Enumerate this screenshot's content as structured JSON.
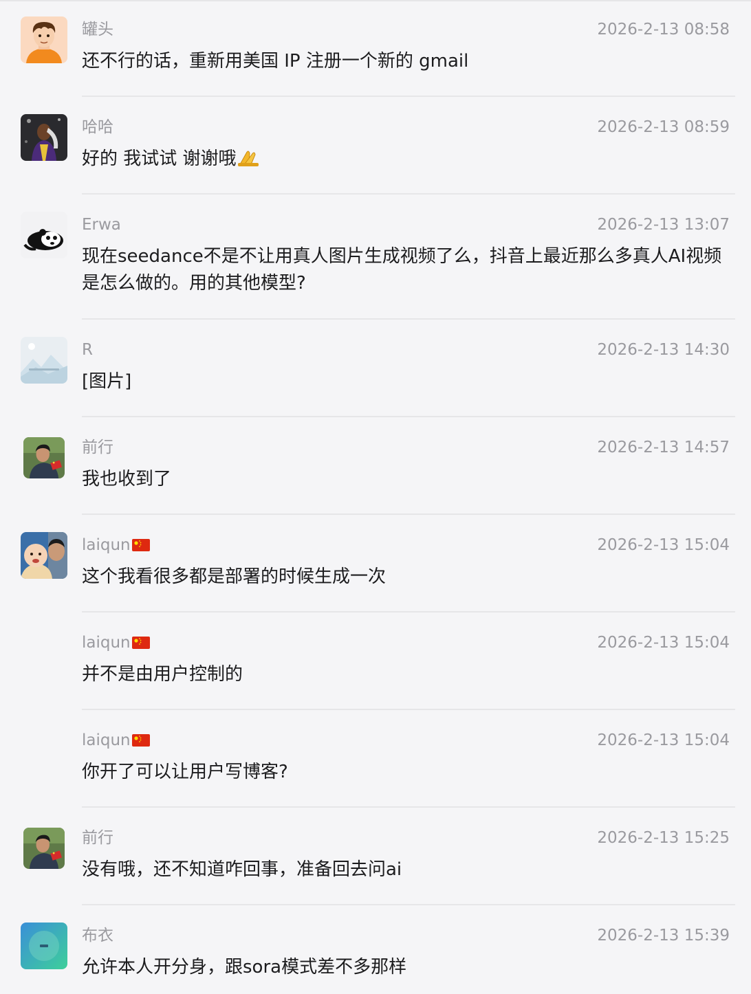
{
  "messages": [
    {
      "name": "罐头",
      "time": "2026-2-13 08:58",
      "text": "还不行的话，重新用美国 IP 注册一个新的 gmail",
      "avatar": "cartoon-boy-avatar"
    },
    {
      "name": "哈哈",
      "time": "2026-2-13 08:59",
      "text": "好的 我试试 谢谢哦",
      "emoji": "folded-hands-icon",
      "avatar": "basketball-player-avatar"
    },
    {
      "name": "Erwa",
      "time": "2026-2-13 13:07",
      "text": "现在seedance不是不让用真人图片生成视频了么，抖音上最近那么多真人AI视频是怎么做的。用的其他模型?",
      "avatar": "panda-avatar"
    },
    {
      "name": "R",
      "time": "2026-2-13 14:30",
      "text": "[图片]",
      "avatar": "landscape-avatar"
    },
    {
      "name": "前行",
      "time": "2026-2-13 14:57",
      "text": "我也收到了",
      "avatar": "man-with-flag-avatar"
    },
    {
      "name": "laiqun",
      "time": "2026-2-13 15:04",
      "text": "这个我看很多都是部署的时候生成一次",
      "flag": "cn-flag-icon",
      "avatar": "family-photo-avatar"
    },
    {
      "name": "laiqun",
      "time": "2026-2-13 15:04",
      "text": "并不是由用户控制的",
      "flag": "cn-flag-icon"
    },
    {
      "name": "laiqun",
      "time": "2026-2-13 15:04",
      "text": "你开了可以让用户写博客?",
      "flag": "cn-flag-icon"
    },
    {
      "name": "前行",
      "time": "2026-2-13 15:25",
      "text": "没有哦，还不知道咋回事，准备回去问ai",
      "avatar": "man-with-flag-avatar"
    },
    {
      "name": "布衣",
      "time": "2026-2-13 15:39",
      "text": "允许本人开分身，跟sora模式差不多那样",
      "avatar": "teal-gradient-avatar"
    }
  ],
  "colors": {
    "background": "#f5f5f7",
    "meta_text": "#9a9a9f",
    "body_text": "#1c1c1e",
    "divider": "#e6e6e8"
  }
}
